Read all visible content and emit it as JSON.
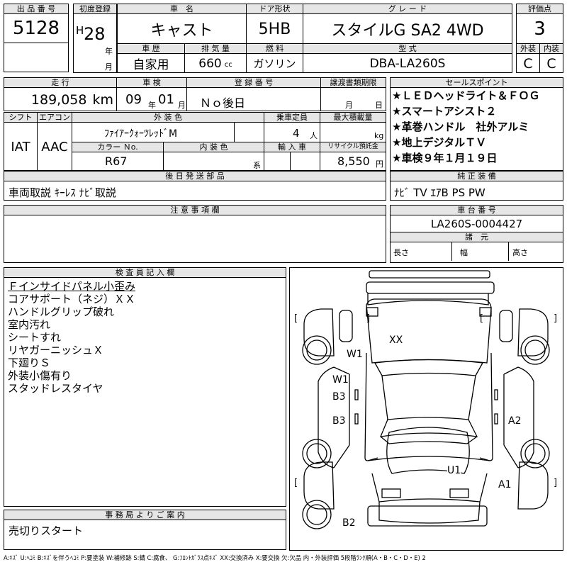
{
  "header": {
    "lot_label": "出 品 番 号",
    "lot": "5128",
    "reg_label": "初度登録",
    "era": "H",
    "reg_year": "28",
    "year_unit": "年",
    "month_unit": "月",
    "name_label": "車　名",
    "name": "キャスト",
    "door_label": "ドア形状",
    "door": "5HB",
    "grade_label": "グ レ ー ド",
    "grade": "スタイルG SA2 4WD",
    "score_label": "評価点",
    "score": "3",
    "history_label": "車 歴",
    "history": "自家用",
    "disp_label": "排 気 量",
    "disp": "660",
    "disp_unit": "cc",
    "fuel_label": "燃 料",
    "fuel": "ガソリン",
    "model_label": "型 式",
    "model": "DBA-LA260S",
    "ext_label": "外装",
    "ext": "C",
    "int_label": "内装",
    "int": "C"
  },
  "row2": {
    "mileage_label": "走 行",
    "mileage": "189,058",
    "mileage_unit": "km",
    "inspect_label": "車 検",
    "inspect_year": "09",
    "inspect_year_unit": "年",
    "inspect_month": "01",
    "inspect_month_unit": "月",
    "plate_label": "登 録 番 号",
    "plate": "Ｎｏ後日",
    "transfer_label": "譲渡書類期限",
    "transfer_month": "月",
    "transfer_day": "日"
  },
  "row3": {
    "shift_label": "シフト",
    "shift": "IAT",
    "ac_label": "エアコン",
    "ac": "AAC",
    "color_label": "外 装 色",
    "color": "ﾌｧｲｱｰｸｫｰﾂﾚｯﾄﾞM",
    "capacity_label": "乗車定員",
    "capacity": "4",
    "capacity_unit": "人",
    "load_label": "最大積載量",
    "load_unit": "kg",
    "color_no_label": "カラー Ｎo.",
    "color_no": "R67",
    "interior_label": "内 装 色",
    "interior_unit": "系",
    "import_label": "輸 入 車",
    "recycle_label": "リサイクル預託金",
    "recycle": "8,550",
    "recycle_unit": "円"
  },
  "sales_points": {
    "label": "セールスポイント",
    "items": [
      "★ＬＥＤヘッドライト＆ＦＯＧ",
      "★スマートアシスト２",
      "★革巻ハンドル　社外アルミ",
      "★地上デジタルＴＶ",
      "★車検９年１月１９日"
    ]
  },
  "later_parts": {
    "label": "後 日 発 送 部 品",
    "value": "車両取説 ｷｰﾚｽ ﾅﾋﾞ取説"
  },
  "equipment": {
    "label": "純 正 装 備",
    "value": "ﾅﾋﾞ TV ｴｱB PS PW"
  },
  "notes": {
    "label": "注 意 事 項 欄",
    "value": ""
  },
  "chassis": {
    "label": "車 台 番 号",
    "value": "LA260S-0004427"
  },
  "dims": {
    "label": "諸　元",
    "length": "長さ",
    "width": "幅",
    "height": "高さ"
  },
  "inspector": {
    "label": "検 査 員 記 入 欄",
    "lines": [
      "Ｆインサイドパネル小歪み",
      "コアサポート（ネジ）ＸＸ",
      "ハンドルグリップ破れ",
      "室内汚れ",
      "シートすれ",
      "リヤガーニッシュＸ",
      "下廻りＳ",
      "外装小傷有り",
      "スタッドレスタイヤ"
    ]
  },
  "office": {
    "label": "事 務 局 よ り ご 案 内",
    "value": "売切りスタート"
  },
  "diagram_marks": [
    "XX",
    "W1",
    "W1",
    "B3",
    "B3",
    "A2",
    "U1",
    "A1",
    "B2"
  ],
  "diagram_brackets": [
    "[",
    "]",
    "[",
    "]",
    "[",
    "]"
  ],
  "legend": "A:ｷｽﾞ U:ﾍｺﾐ B:ｷｽﾞを伴うﾍｺﾐ P:要塗装 W:補修跡 S:錆 C:腐食、 G:ﾌﾛﾝﾄｶﾞﾗｽ点ｷｽﾞ XX:交換済み X:要交換 欠:欠品 内・外装評価 5段階ﾗﾝｸ順(A・B・C・D・E) 2"
}
